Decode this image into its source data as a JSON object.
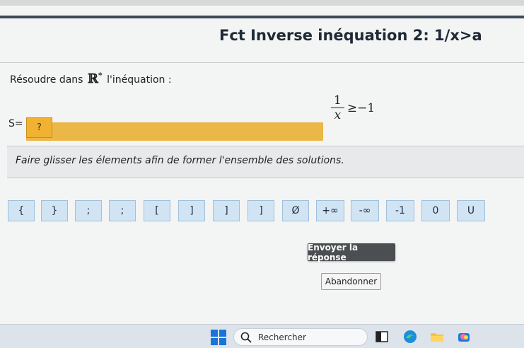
{
  "header": {
    "title": "Fct Inverse inéquation 2: 1/x>a"
  },
  "question": {
    "prefix": "Résoudre dans",
    "set_symbol": "ℝ",
    "set_superscript": "*",
    "suffix": "l'inéquation :",
    "inequality": {
      "numerator": "1",
      "denominator": "x",
      "operator": "≥",
      "rhs": "−1"
    }
  },
  "answer": {
    "label": "S=",
    "placeholder": "?"
  },
  "hint": "Faire glisser les élements afin de former l'ensemble des solutions.",
  "tiles": [
    "{",
    "}",
    ";",
    ";",
    "[",
    "]",
    "]",
    "]",
    "Ø",
    "+∞",
    "-∞",
    "-1",
    "0",
    "U"
  ],
  "buttons": {
    "submit": "Envoyer la réponse",
    "cancel": "Abandonner"
  },
  "taskbar": {
    "search_placeholder": "Rechercher"
  },
  "colors": {
    "accent": "#ebb747",
    "tile": "#d0e4f4",
    "submit": "#4c4f52"
  }
}
